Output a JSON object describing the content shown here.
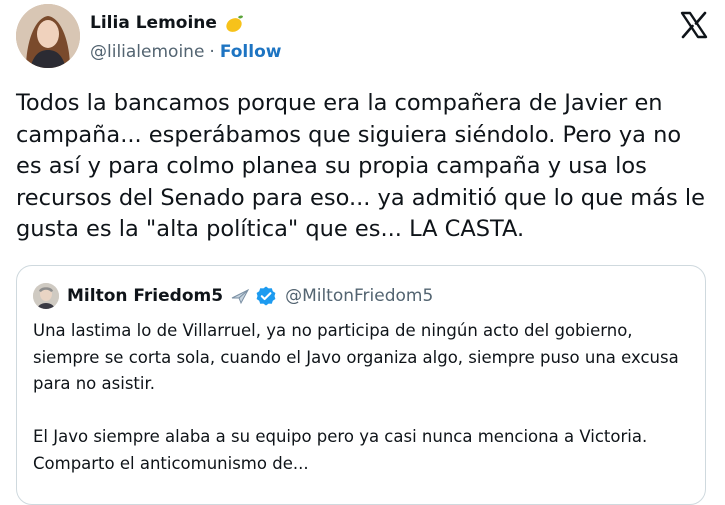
{
  "author": {
    "display_name": "Lilia Lemoine",
    "handle": "@lilialemoine",
    "separator": "·",
    "follow_label": "Follow",
    "emoji_icon": "lemon-icon"
  },
  "tweet": {
    "text": "Todos la bancamos porque era la compañera de Javier en campaña... esperábamos que siguiera siéndolo. Pero ya no es así y para colmo planea su propia campaña y usa los recursos del Senado para eso... ya admitió que lo que más le gusta es la \"alta política\" que es... LA CASTA."
  },
  "quote": {
    "display_name": "Milton Friedom5",
    "handle": "@MiltonFriedom5",
    "icons": [
      "airplane-icon",
      "verified-badge-icon"
    ],
    "text": "Una lastima lo de Villarruel, ya no participa de ningún acto del gobierno, siempre se corta sola, cuando el Javo organiza algo, siempre puso una excusa para no asistir.\n\nEl Javo siempre alaba a su equipo pero ya casi nunca menciona a Victoria. Comparto el anticomunismo de..."
  },
  "colors": {
    "text": "#0f1419",
    "secondary": "#536471",
    "link": "#1d74c2",
    "verified": "#1d9bf0",
    "border": "#cfd9de"
  }
}
